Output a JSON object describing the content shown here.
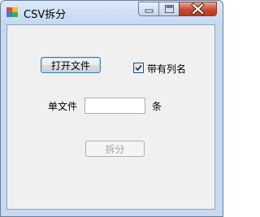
{
  "window": {
    "title": "CSV拆分",
    "controls": {
      "minimize": "minimize",
      "maximize": "maximize",
      "close": "close"
    }
  },
  "form": {
    "open_file_button": "打开文件",
    "has_header_checkbox": {
      "label": "带有列名",
      "checked": true
    },
    "single_file_label": "单文件",
    "single_file_input": {
      "value": "",
      "placeholder": ""
    },
    "unit_label": "条",
    "split_button": {
      "label": "拆分",
      "enabled": false
    }
  }
}
